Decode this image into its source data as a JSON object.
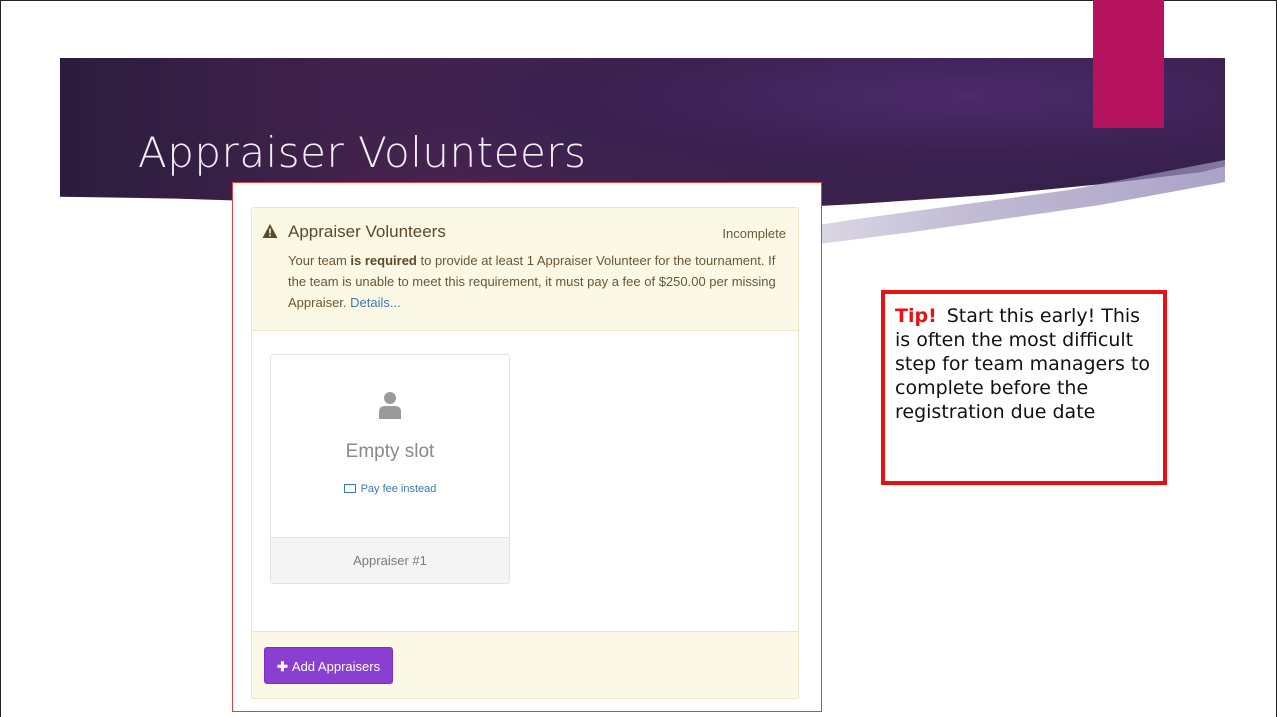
{
  "slide": {
    "title": "Appraiser Volunteers",
    "accent_color": "#b5135e"
  },
  "panel": {
    "title": "Appraiser Volunteers",
    "status": "Incomplete",
    "desc_before": "Your team ",
    "desc_bold": "is required",
    "desc_after": " to provide at least 1 Appraiser Volunteer for the tournament. If the team is unable to meet this requirement, it must pay a fee of $250.00 per missing Appraiser. ",
    "details_link": "Details...",
    "warning_icon": "warning-triangle-icon"
  },
  "slot": {
    "icon": "person-icon",
    "label": "Empty slot",
    "pay_fee": "Pay fee instead",
    "footer": "Appraiser #1"
  },
  "footer": {
    "add_button": "Add Appraisers",
    "button_color": "#8a3fd0"
  },
  "tip": {
    "label": "Tip!",
    "text": "Start this early! This is often the most difficult step for team managers to complete before the registration due date",
    "border_color": "#e81010"
  }
}
